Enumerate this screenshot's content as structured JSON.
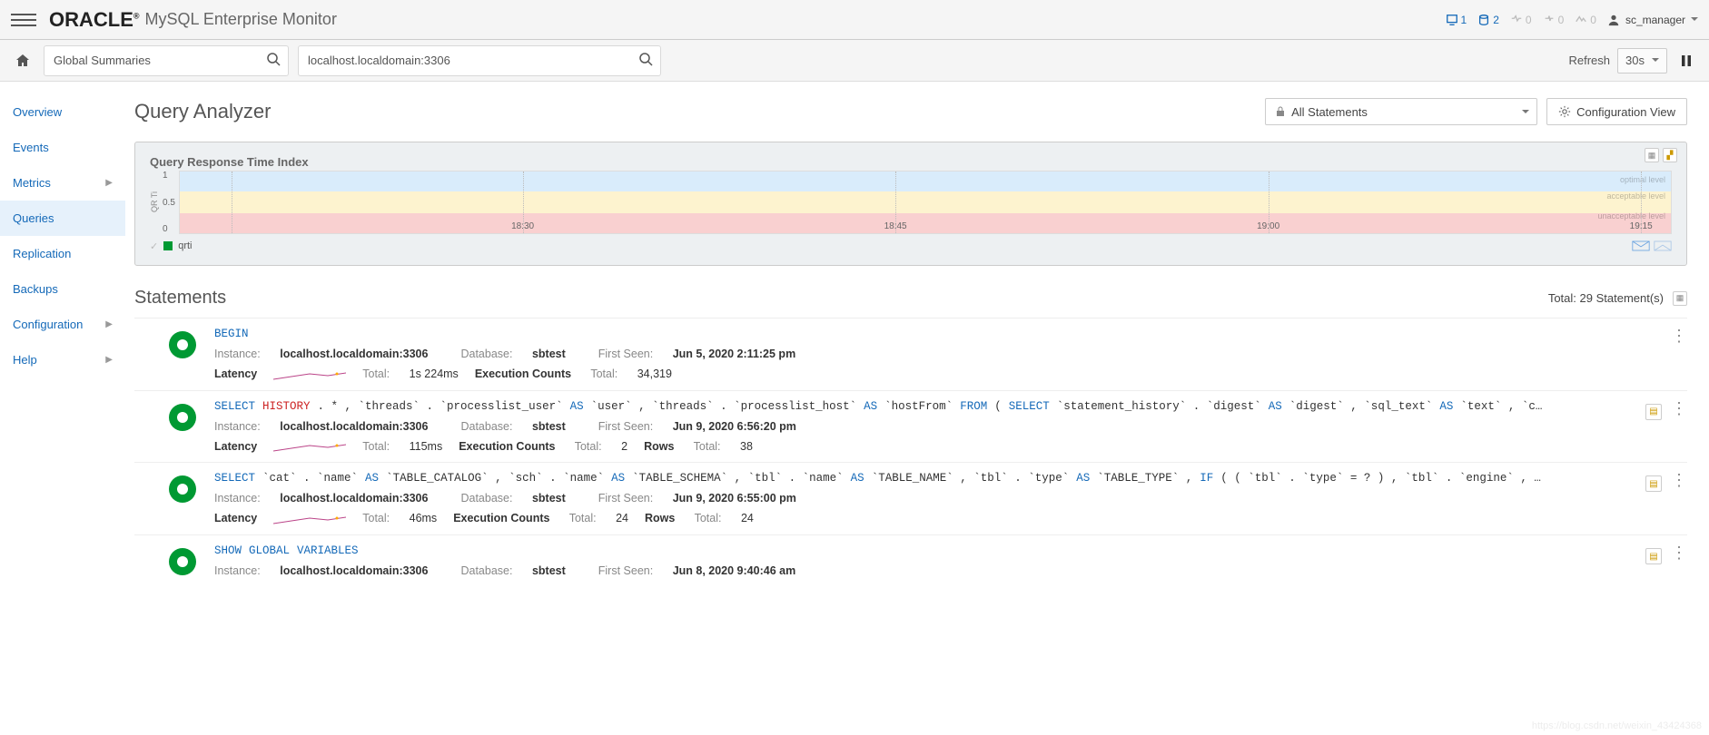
{
  "brand": "ORACLE",
  "subbrand": "MySQL Enterprise Monitor",
  "status": {
    "hosts": "1",
    "instances": "2",
    "warning": "0",
    "critical": "0",
    "emergency": "0"
  },
  "user": {
    "name": "sc_manager"
  },
  "toolbar": {
    "combo1": "Global Summaries",
    "combo2": "localhost.localdomain:3306",
    "refresh_label": "Refresh",
    "refresh_interval": "30s"
  },
  "sidebar": {
    "items": [
      {
        "label": "Overview",
        "has_sub": false
      },
      {
        "label": "Events",
        "has_sub": false
      },
      {
        "label": "Metrics",
        "has_sub": true
      },
      {
        "label": "Queries",
        "has_sub": false,
        "active": true
      },
      {
        "label": "Replication",
        "has_sub": false
      },
      {
        "label": "Backups",
        "has_sub": false
      },
      {
        "label": "Configuration",
        "has_sub": true
      },
      {
        "label": "Help",
        "has_sub": true
      }
    ]
  },
  "page": {
    "title": "Query Analyzer",
    "filter_value": "All Statements",
    "config_btn": "Configuration View"
  },
  "chart": {
    "title": "Query Response Time Index",
    "y_label": "QR Ti",
    "legend": "qrti",
    "levels": {
      "optimal": "optimal level",
      "acceptable": "acceptable level",
      "unacceptable": "unacceptable level"
    }
  },
  "chart_data": {
    "type": "area",
    "title": "Query Response Time Index",
    "ylabel": "QR Ti",
    "ylim": [
      0,
      1
    ],
    "y_ticks": [
      0,
      0.5,
      1
    ],
    "x_ticks": [
      "18:30",
      "18:45",
      "19:00",
      "19:15"
    ],
    "bands": [
      {
        "name": "optimal level",
        "from": 0.67,
        "to": 1.0,
        "color": "#d9ecfb"
      },
      {
        "name": "acceptable level",
        "from": 0.33,
        "to": 0.67,
        "color": "#fdf3cf"
      },
      {
        "name": "unacceptable level",
        "from": 0.0,
        "to": 0.33,
        "color": "#f9d0d0"
      }
    ],
    "series": [
      {
        "name": "qrti",
        "values": []
      }
    ]
  },
  "statements": {
    "title": "Statements",
    "total_label": "Total: 29 Statement(s)",
    "rows": [
      {
        "sql_html": "<span class='kw'>BEGIN</span>",
        "instance": "localhost.localdomain:3306",
        "database": "sbtest",
        "first_seen": "Jun 5, 2020 2:11:25 pm",
        "latency_total": "1s 224ms",
        "exec_total": "34,319",
        "rows_total": "",
        "has_copy": false
      },
      {
        "sql_html": "<span class='kw'>SELECT</span> <span class='hl'>HISTORY</span> . * , `threads` . `processlist_user` <span class='kw'>AS</span> `user` , `threads` . `processlist_host` <span class='kw'>AS</span> `hostFrom` <span class='kw'>FROM</span> ( <span class='kw'>SELECT</span> `statement_history` . `digest` <span class='kw'>AS</span> `digest` , `sql_text` <span class='kw'>AS</span> `text` , `c…",
        "instance": "localhost.localdomain:3306",
        "database": "sbtest",
        "first_seen": "Jun 9, 2020 6:56:20 pm",
        "latency_total": "115ms",
        "exec_total": "2",
        "rows_total": "38",
        "has_copy": true
      },
      {
        "sql_html": "<span class='kw'>SELECT</span> `cat` . `name` <span class='kw'>AS</span> `TABLE_CATALOG` , `sch` . `name` <span class='kw'>AS</span> `TABLE_SCHEMA` , `tbl` . `name` <span class='kw'>AS</span> `TABLE_NAME` , `tbl` . `type` <span class='kw'>AS</span> `TABLE_TYPE` , <span class='kw'>IF</span> ( ( `tbl` . `type` = ? ) , `tbl` . `engine` , …",
        "instance": "localhost.localdomain:3306",
        "database": "sbtest",
        "first_seen": "Jun 9, 2020 6:55:00 pm",
        "latency_total": "46ms",
        "exec_total": "24",
        "rows_total": "24",
        "has_copy": true
      },
      {
        "sql_html": "<span class='kw'>SHOW</span> <span class='kw'>GLOBAL</span> <span class='kw'>VARIABLES</span>",
        "instance": "localhost.localdomain:3306",
        "database": "sbtest",
        "first_seen": "Jun 8, 2020 9:40:46 am",
        "latency_total": "",
        "exec_total": "",
        "rows_total": "",
        "has_copy": true
      }
    ],
    "labels": {
      "instance": "Instance:",
      "database": "Database:",
      "first_seen": "First Seen:",
      "latency": "Latency",
      "total": "Total:",
      "exec": "Execution Counts",
      "rows": "Rows"
    }
  },
  "watermark": "https://blog.csdn.net/weixin_43424368"
}
